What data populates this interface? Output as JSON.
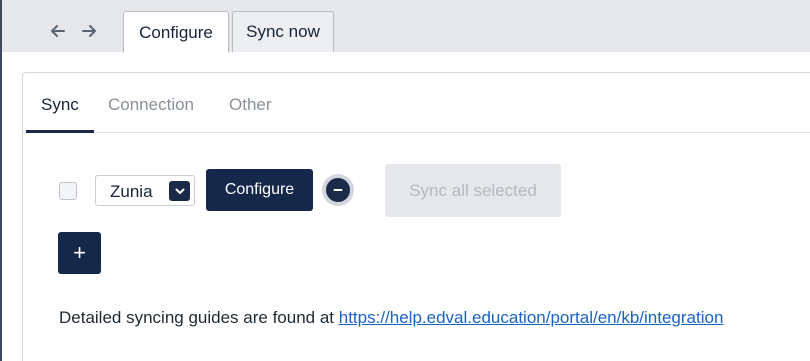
{
  "nav": {
    "back_icon": "arrow-left-icon",
    "forward_icon": "arrow-right-icon"
  },
  "top_tabs": [
    {
      "label": "Configure",
      "active": true
    },
    {
      "label": "Sync now",
      "active": false
    }
  ],
  "sub_tabs": [
    {
      "label": "Sync",
      "active": true
    },
    {
      "label": "Connection",
      "active": false
    },
    {
      "label": "Other",
      "active": false
    }
  ],
  "sync_row": {
    "checked": false,
    "provider_selected": "Zunia",
    "configure_label": "Configure",
    "remove_icon": "minus-circle-icon",
    "sync_all_label": "Sync all selected",
    "sync_all_enabled": false
  },
  "add_label": "+",
  "guide": {
    "text": "Detailed syncing guides are found at ",
    "link": "https://help.edval.education/portal/en/kb/integration"
  },
  "colors": {
    "primary": "#16284a",
    "link": "#1a63c6",
    "disabled_bg": "#e5e7eb",
    "disabled_text": "#b4b9c1",
    "strip_bg": "#e6e7eb"
  }
}
